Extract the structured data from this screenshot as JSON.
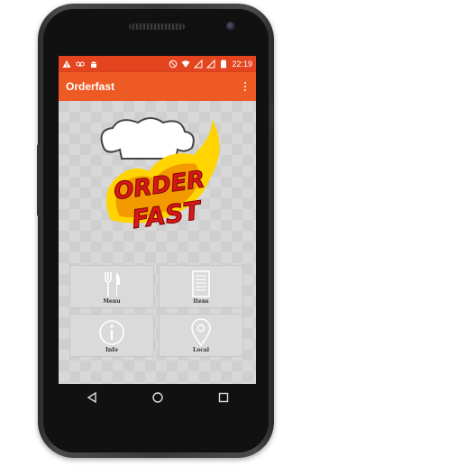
{
  "status_bar": {
    "time": "22:19",
    "left_icons": [
      "warning-icon",
      "voicemail-icon",
      "android-icon"
    ],
    "right_icons": [
      "no-disturb-icon",
      "wifi-icon",
      "signal-icon",
      "signal-icon",
      "battery-icon"
    ]
  },
  "app_bar": {
    "title": "Orderfast",
    "menu_icon": "overflow-menu-icon"
  },
  "logo": {
    "line1": "ORDER",
    "line2": "FAST"
  },
  "tiles": [
    {
      "label": "Menu",
      "icon": "fork-knife-icon"
    },
    {
      "label": "Itens",
      "icon": "list-icon"
    },
    {
      "label": "Info",
      "icon": "info-icon"
    },
    {
      "label": "Local",
      "icon": "location-pin-icon"
    }
  ],
  "nav": [
    "back-icon",
    "home-icon",
    "recents-icon"
  ],
  "colors": {
    "status_bar": "#e4451f",
    "app_bar": "#ee5a24",
    "logo_red": "#d81818",
    "logo_yellow": "#ffd400"
  }
}
